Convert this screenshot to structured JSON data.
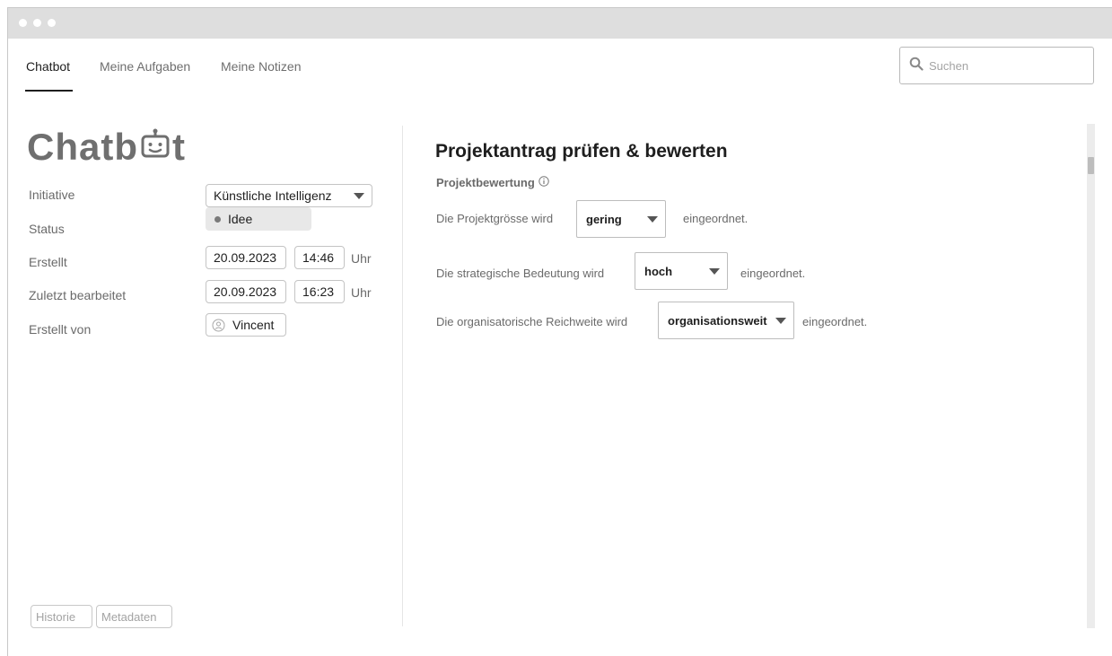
{
  "nav": {
    "tabs": [
      {
        "label": "Chatbot",
        "active": true
      },
      {
        "label": "Meine Aufgaben",
        "active": false
      },
      {
        "label": "Meine Notizen",
        "active": false
      }
    ],
    "search_placeholder": "Suchen"
  },
  "sidebar": {
    "logo_text_start": "Chatb",
    "logo_text_end": "t",
    "fields": {
      "initiative": {
        "label": "Initiative",
        "value": "Künstliche Intelligenz"
      },
      "status": {
        "label": "Status",
        "value": "Idee"
      },
      "created": {
        "label": "Erstellt",
        "date": "20.09.2023",
        "time": "14:46",
        "unit": "Uhr"
      },
      "edited": {
        "label": "Zuletzt bearbeitet",
        "date": "20.09.2023",
        "time": "16:23",
        "unit": "Uhr"
      },
      "author": {
        "label": "Erstellt von",
        "value": "Vincent"
      }
    },
    "buttons": {
      "history": "Historie",
      "metadata": "Metadaten"
    }
  },
  "main": {
    "title": "Projektantrag prüfen & bewerten",
    "section_label": "Projektbewertung",
    "rows": [
      {
        "prefix": "Die Projektgrösse wird",
        "value": "gering",
        "suffix": "eingeordnet."
      },
      {
        "prefix": "Die strategische Bedeutung wird",
        "value": "hoch",
        "suffix": "eingeordnet."
      },
      {
        "prefix": "Die organisatorische Reichweite wird",
        "value": "organisationsweit",
        "suffix": "eingeordnet."
      }
    ]
  },
  "colors": {
    "titlebar": "#dedede",
    "text_primary": "#1e1e1e",
    "text_secondary": "#6a6a6a",
    "status_pill": "#e8e8e8"
  },
  "icons": {
    "search": "search-icon",
    "logo_robot": "robot-icon",
    "info": "info-icon",
    "user": "user-icon",
    "dropdown": "caret-down-icon"
  }
}
